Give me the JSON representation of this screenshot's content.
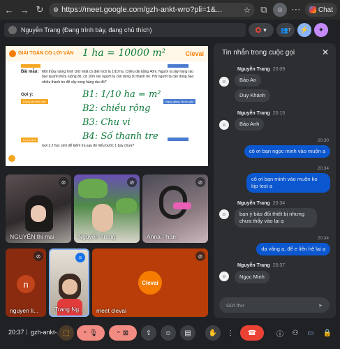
{
  "browser": {
    "url": "https://meet.google.com/gzh-ankt-wro?pli=1&...",
    "chat_label": "Chat"
  },
  "presenter": {
    "label": "Nguyễn Trang (Đang trình bày, đang chủ thích)"
  },
  "top_controls": {
    "participants_count": "7"
  },
  "slide": {
    "header_title": "GIẢI TOÁN CÓ LỜI VĂN",
    "brand": "Clevai",
    "handwritten_top": "1 ha = 10000 m²",
    "problem_label": "Bài mẫu:",
    "problem_text": "Một thửa ruộng hình chữ nhật có diện tích là 1/10 ha. Chiều dài bằng 40m. Người ta xây hàng rào bao quanh thửa ruộng đó, cứ 10m rào người ta cần dùng 10 thanh tre. Hỏi người ta cần dùng bao nhiêu thanh tre để xây xong hàng rào đó?",
    "hint_label": "Gợi ý:",
    "steps": [
      "B1: 1/10 ha = m²",
      "B2: chiều rộng",
      "B3: Chu vi",
      "B4: Số thanh tre"
    ],
    "tag_a": "Dùng kết thức cần",
    "tag_b": "Ngày giảng: Bước giải",
    "tag_c": "Lưu ý chú",
    "footer_text": "Gợi ý 2 học sinh để kiểm tra sau đó hiểu bước 1 bay chưa?"
  },
  "tiles": [
    {
      "name": "NGUYỄN thi mai"
    },
    {
      "name": "Nguyễn Trang"
    },
    {
      "name": "Anna Pham"
    },
    {
      "name": "nguyen li...",
      "initial": "n"
    },
    {
      "name": "Trang Ng..."
    },
    {
      "name": "meet clevai",
      "logo": "Clevai"
    }
  ],
  "chat": {
    "title": "Tin nhắn trong cuộc gọi",
    "input_placeholder": "Gửi thư",
    "messages": [
      {
        "sender": "Nguyễn Trang",
        "time": "20:09",
        "lines": [
          "Bảo An",
          "Duy Khánh"
        ]
      },
      {
        "sender": "Nguyễn Trang",
        "time": "20:15",
        "lines": [
          "Bảo Anh"
        ]
      },
      {
        "time": "20:30",
        "outgoing": "cô ơi bạn ngọc minh vào muộn ạ"
      },
      {
        "time": "20:34",
        "outgoing": "cô ơi bạn minh vào muộn ko kịp test ạ"
      },
      {
        "sender": "Nguyễn Trang",
        "time": "20:34",
        "lines": [
          "bạn ý bảo đổi thiết bị nhưng chưa thấy vào lại ạ"
        ]
      },
      {
        "time": "20:34",
        "outgoing": "dạ vâng ạ, để e liên hệ lại ạ"
      },
      {
        "sender": "Nguyễn Trang",
        "time": "20:37",
        "lines": [
          "Ngọc Minh"
        ]
      }
    ]
  },
  "bottom": {
    "time": "20:37",
    "meeting_code": "gzh-ankt-..."
  },
  "colors": {
    "accent_blue": "#0b57d0",
    "danger_red": "#ea4335",
    "clevai_orange": "#f57c00"
  }
}
